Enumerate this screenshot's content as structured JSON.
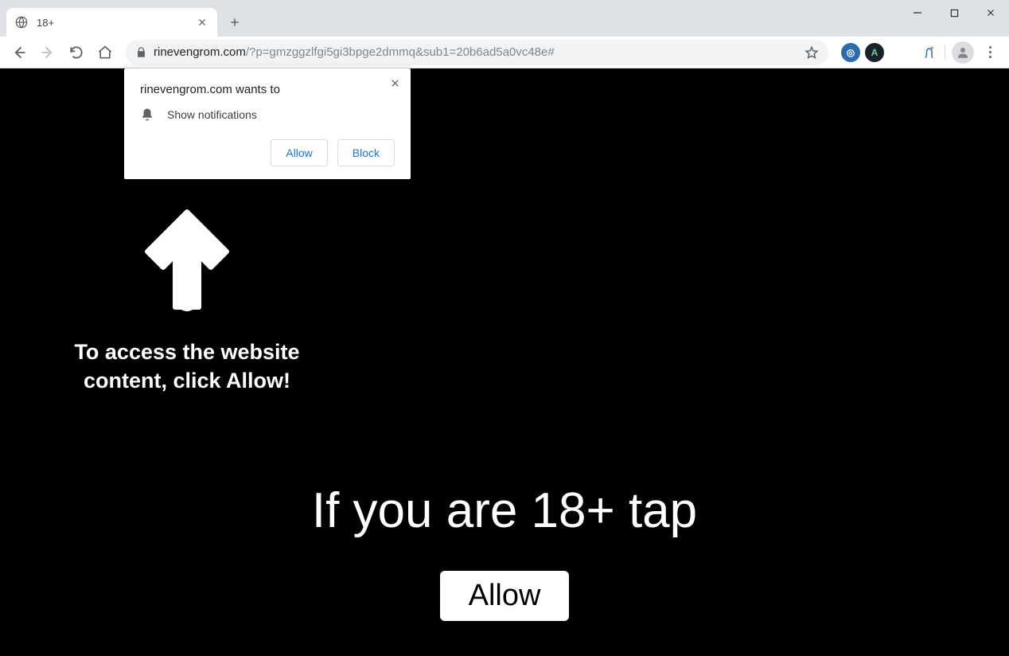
{
  "window": {
    "tab_title": "18+"
  },
  "toolbar": {
    "url_domain": "rinevengrom.com",
    "url_path": "/?p=gmzggzlfgi5gi3bpge2dmmq&sub1=20b6ad5a0vc48e#"
  },
  "permission_popup": {
    "title": "rinevengrom.com wants to",
    "item": "Show notifications",
    "allow_label": "Allow",
    "block_label": "Block"
  },
  "page": {
    "arrow_text": "To access the website content, click Allow!",
    "headline": "If you are 18+ tap",
    "allow_button": "Allow"
  }
}
